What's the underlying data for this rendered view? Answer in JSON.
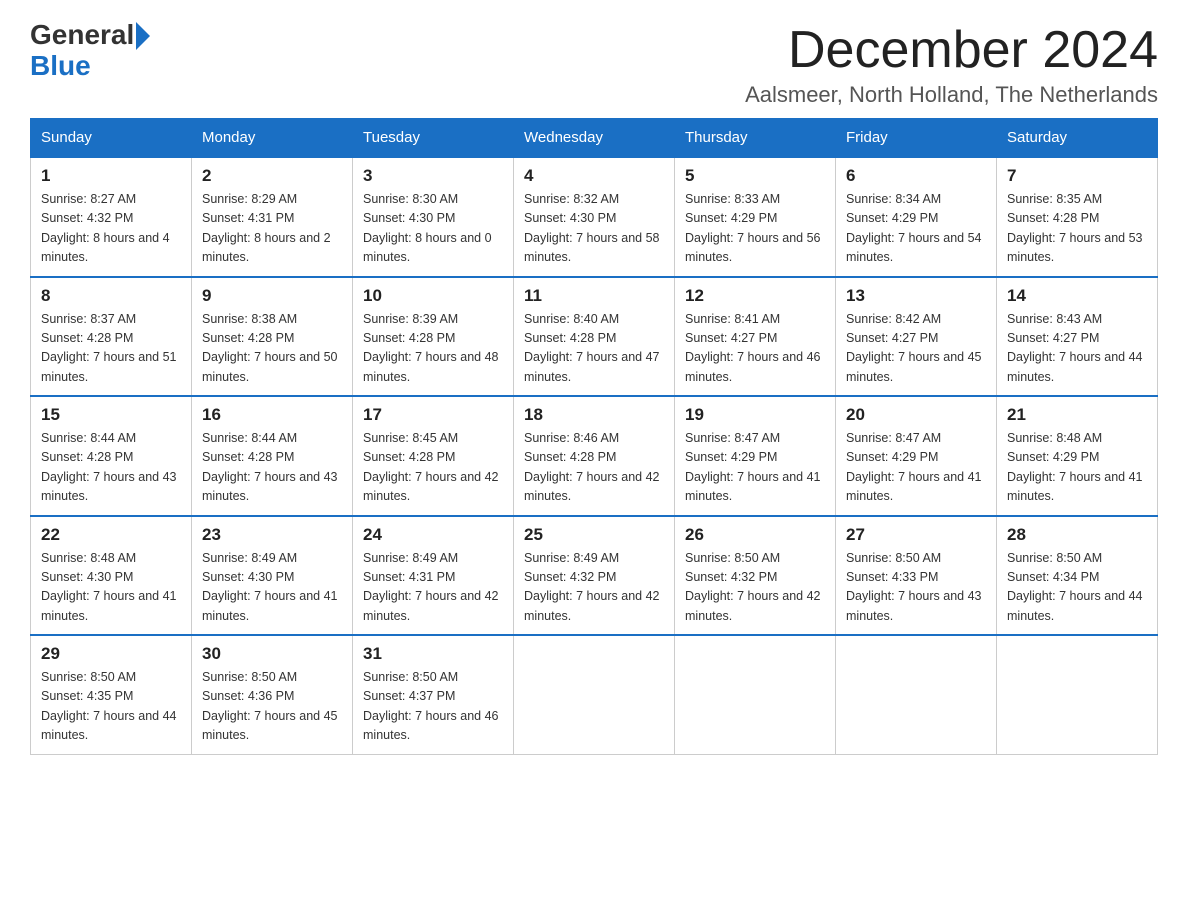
{
  "header": {
    "logo_general": "General",
    "logo_blue": "Blue",
    "month_title": "December 2024",
    "location": "Aalsmeer, North Holland, The Netherlands"
  },
  "weekdays": [
    "Sunday",
    "Monday",
    "Tuesday",
    "Wednesday",
    "Thursday",
    "Friday",
    "Saturday"
  ],
  "weeks": [
    [
      {
        "day": "1",
        "sunrise": "8:27 AM",
        "sunset": "4:32 PM",
        "daylight": "8 hours and 4 minutes."
      },
      {
        "day": "2",
        "sunrise": "8:29 AM",
        "sunset": "4:31 PM",
        "daylight": "8 hours and 2 minutes."
      },
      {
        "day": "3",
        "sunrise": "8:30 AM",
        "sunset": "4:30 PM",
        "daylight": "8 hours and 0 minutes."
      },
      {
        "day": "4",
        "sunrise": "8:32 AM",
        "sunset": "4:30 PM",
        "daylight": "7 hours and 58 minutes."
      },
      {
        "day": "5",
        "sunrise": "8:33 AM",
        "sunset": "4:29 PM",
        "daylight": "7 hours and 56 minutes."
      },
      {
        "day": "6",
        "sunrise": "8:34 AM",
        "sunset": "4:29 PM",
        "daylight": "7 hours and 54 minutes."
      },
      {
        "day": "7",
        "sunrise": "8:35 AM",
        "sunset": "4:28 PM",
        "daylight": "7 hours and 53 minutes."
      }
    ],
    [
      {
        "day": "8",
        "sunrise": "8:37 AM",
        "sunset": "4:28 PM",
        "daylight": "7 hours and 51 minutes."
      },
      {
        "day": "9",
        "sunrise": "8:38 AM",
        "sunset": "4:28 PM",
        "daylight": "7 hours and 50 minutes."
      },
      {
        "day": "10",
        "sunrise": "8:39 AM",
        "sunset": "4:28 PM",
        "daylight": "7 hours and 48 minutes."
      },
      {
        "day": "11",
        "sunrise": "8:40 AM",
        "sunset": "4:28 PM",
        "daylight": "7 hours and 47 minutes."
      },
      {
        "day": "12",
        "sunrise": "8:41 AM",
        "sunset": "4:27 PM",
        "daylight": "7 hours and 46 minutes."
      },
      {
        "day": "13",
        "sunrise": "8:42 AM",
        "sunset": "4:27 PM",
        "daylight": "7 hours and 45 minutes."
      },
      {
        "day": "14",
        "sunrise": "8:43 AM",
        "sunset": "4:27 PM",
        "daylight": "7 hours and 44 minutes."
      }
    ],
    [
      {
        "day": "15",
        "sunrise": "8:44 AM",
        "sunset": "4:28 PM",
        "daylight": "7 hours and 43 minutes."
      },
      {
        "day": "16",
        "sunrise": "8:44 AM",
        "sunset": "4:28 PM",
        "daylight": "7 hours and 43 minutes."
      },
      {
        "day": "17",
        "sunrise": "8:45 AM",
        "sunset": "4:28 PM",
        "daylight": "7 hours and 42 minutes."
      },
      {
        "day": "18",
        "sunrise": "8:46 AM",
        "sunset": "4:28 PM",
        "daylight": "7 hours and 42 minutes."
      },
      {
        "day": "19",
        "sunrise": "8:47 AM",
        "sunset": "4:29 PM",
        "daylight": "7 hours and 41 minutes."
      },
      {
        "day": "20",
        "sunrise": "8:47 AM",
        "sunset": "4:29 PM",
        "daylight": "7 hours and 41 minutes."
      },
      {
        "day": "21",
        "sunrise": "8:48 AM",
        "sunset": "4:29 PM",
        "daylight": "7 hours and 41 minutes."
      }
    ],
    [
      {
        "day": "22",
        "sunrise": "8:48 AM",
        "sunset": "4:30 PM",
        "daylight": "7 hours and 41 minutes."
      },
      {
        "day": "23",
        "sunrise": "8:49 AM",
        "sunset": "4:30 PM",
        "daylight": "7 hours and 41 minutes."
      },
      {
        "day": "24",
        "sunrise": "8:49 AM",
        "sunset": "4:31 PM",
        "daylight": "7 hours and 42 minutes."
      },
      {
        "day": "25",
        "sunrise": "8:49 AM",
        "sunset": "4:32 PM",
        "daylight": "7 hours and 42 minutes."
      },
      {
        "day": "26",
        "sunrise": "8:50 AM",
        "sunset": "4:32 PM",
        "daylight": "7 hours and 42 minutes."
      },
      {
        "day": "27",
        "sunrise": "8:50 AM",
        "sunset": "4:33 PM",
        "daylight": "7 hours and 43 minutes."
      },
      {
        "day": "28",
        "sunrise": "8:50 AM",
        "sunset": "4:34 PM",
        "daylight": "7 hours and 44 minutes."
      }
    ],
    [
      {
        "day": "29",
        "sunrise": "8:50 AM",
        "sunset": "4:35 PM",
        "daylight": "7 hours and 44 minutes."
      },
      {
        "day": "30",
        "sunrise": "8:50 AM",
        "sunset": "4:36 PM",
        "daylight": "7 hours and 45 minutes."
      },
      {
        "day": "31",
        "sunrise": "8:50 AM",
        "sunset": "4:37 PM",
        "daylight": "7 hours and 46 minutes."
      },
      null,
      null,
      null,
      null
    ]
  ]
}
